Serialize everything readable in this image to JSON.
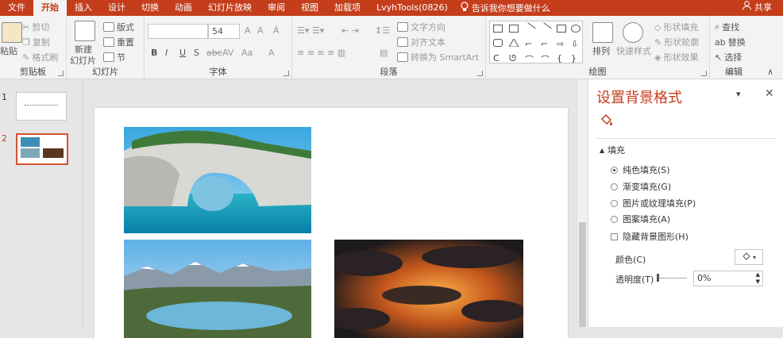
{
  "ribbon_tabs": [
    "文件",
    "开始",
    "插入",
    "设计",
    "切换",
    "动画",
    "幻灯片放映",
    "审阅",
    "视图",
    "加载项",
    "LvyhTools(0826)"
  ],
  "tell_me": "告诉我你想要做什么",
  "share": "共享",
  "clipboard": {
    "paste": "粘贴",
    "cut": "剪切",
    "copy": "复制",
    "format_painter": "格式刷",
    "label": "剪贴板"
  },
  "slides_group": {
    "new_slide_line1": "新建",
    "new_slide_line2": "幻灯片",
    "layout": "版式",
    "reset": "重置",
    "section": "节",
    "label": "幻灯片"
  },
  "font_group": {
    "font_name": "",
    "font_size": "54",
    "grow": "A",
    "shrink": "A",
    "bold": "B",
    "italic": "I",
    "underline": "U",
    "shadow": "S",
    "strike": "abc",
    "spacing": "AV",
    "case": "Aa",
    "color": "A",
    "label": "字体"
  },
  "paragraph_group": {
    "text_direction": "文字方向",
    "align_text": "对齐文本",
    "smartart": "转换为 SmartArt",
    "label": "段落"
  },
  "drawing_group": {
    "arrange": "排列",
    "quick_styles": "快速样式",
    "shape_fill": "形状填充",
    "shape_outline": "形状轮廓",
    "shape_effects": "形状效果",
    "label": "绘图"
  },
  "editing_group": {
    "find": "查找",
    "replace": "替换",
    "select": "选择",
    "label": "编辑"
  },
  "slide_numbers": [
    "1",
    "2"
  ],
  "pane": {
    "title": "设置背景格式",
    "section": "填充",
    "fill_options": [
      "纯色填充(S)",
      "渐变填充(G)",
      "图片或纹理填充(P)",
      "图案填充(A)"
    ],
    "selected_fill": 0,
    "hide_bg": "隐藏背景图形(H)",
    "color_label": "颜色(C)",
    "transparency_label": "透明度(T)",
    "transparency_value": "0%"
  },
  "colors": {
    "accent": "#c43e1c"
  }
}
